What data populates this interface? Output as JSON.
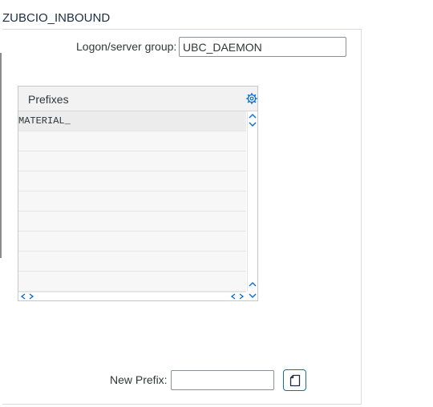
{
  "window": {
    "title": "ZUBCIO_INBOUND"
  },
  "logon": {
    "label": "Logon/server group:",
    "value": "UBC_DAEMON"
  },
  "prefixes_table": {
    "header": "Prefixes",
    "rows": [
      "MATERIAL_",
      "",
      "",
      "",
      "",
      "",
      "",
      "",
      ""
    ]
  },
  "new_prefix": {
    "label": "New Prefix:",
    "value": ""
  },
  "icons": {
    "settings": "settings-gear-icon",
    "scroll_up": "chevron-up-icon",
    "scroll_down": "chevron-down-icon",
    "scroll_left": "chevron-left-icon",
    "scroll_right": "chevron-right-icon",
    "add": "new-document-icon"
  },
  "colors": {
    "accent": "#0a6ed1",
    "text": "#32363a",
    "header_bg": "#f2f2f2"
  }
}
